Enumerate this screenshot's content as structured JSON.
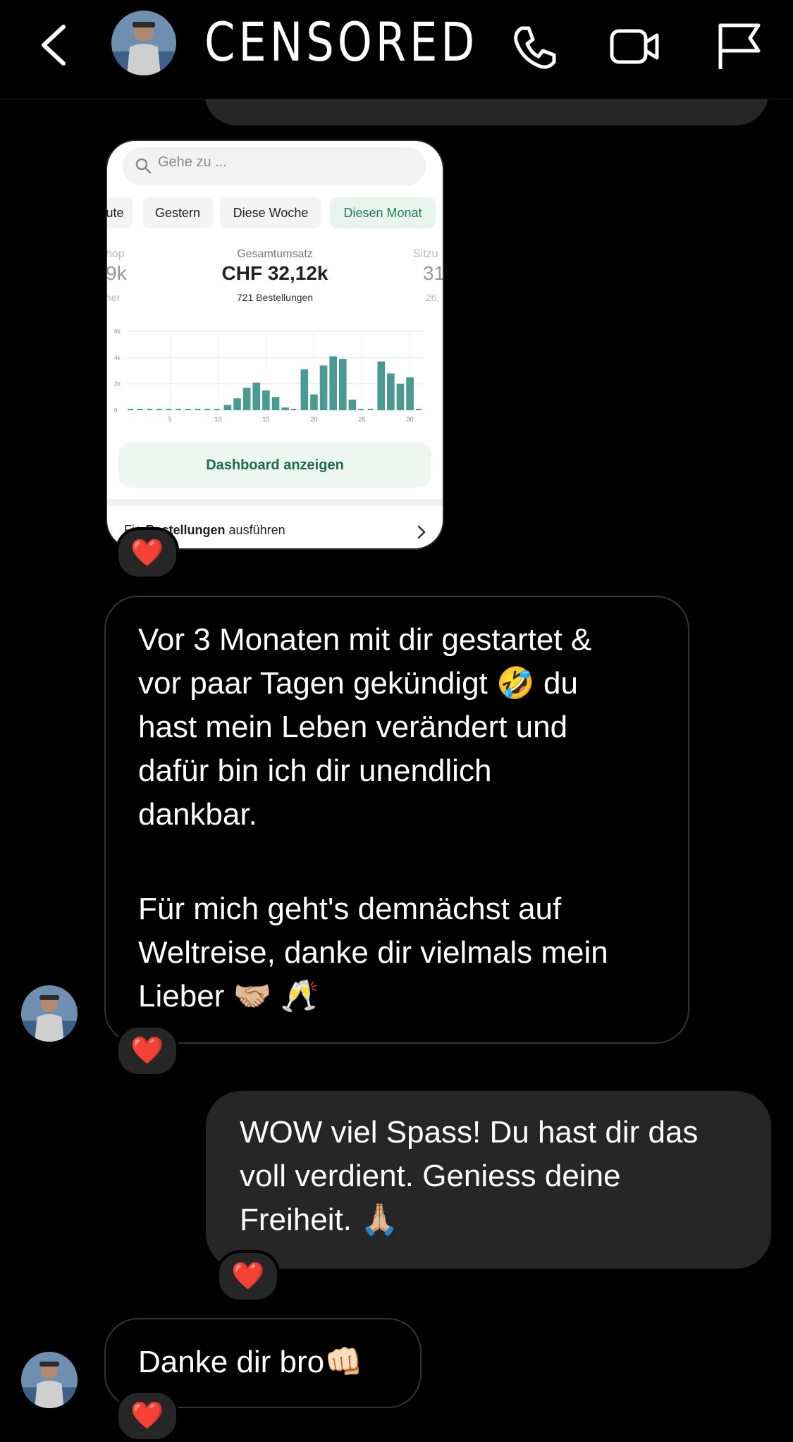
{
  "header": {
    "contact_name": "CENSORED",
    "back_icon": "chevron-left-icon",
    "call_icon": "phone-icon",
    "video_icon": "video-camera-icon",
    "report_icon": "flag-icon"
  },
  "shared_screenshot": {
    "search_placeholder": "Gehe zu ...",
    "tabs": [
      "ute",
      "Gestern",
      "Diese Woche",
      "Diesen Monat"
    ],
    "active_tab": "Diesen Monat",
    "metric_left": {
      "label": "hop",
      "value": "9k",
      "sub": "her"
    },
    "metric_main": {
      "label": "Gesamtumsatz",
      "value": "CHF 32,12k",
      "sub": "721 Bestellungen"
    },
    "metric_right": {
      "label": "Sitzu",
      "value": "31",
      "sub": "26,"
    },
    "dashboard_button": "Dashboard anzeigen",
    "footer_bold": "Bestellungen",
    "footer_rest": " ausführen",
    "footer_prefix": "Fi",
    "chart_data": {
      "type": "bar",
      "x": [
        1,
        2,
        3,
        4,
        5,
        6,
        7,
        8,
        9,
        10,
        11,
        12,
        13,
        14,
        15,
        16,
        17,
        18,
        19,
        20,
        21,
        22,
        23,
        24,
        25,
        26,
        27,
        28,
        29,
        30,
        31
      ],
      "values": [
        0,
        0,
        0,
        0,
        0,
        0,
        0,
        0,
        0,
        0,
        400,
        900,
        1700,
        2100,
        1500,
        1000,
        200,
        0,
        3100,
        1200,
        3400,
        4100,
        3900,
        800,
        0,
        0,
        3700,
        2800,
        2000,
        2500,
        0
      ],
      "ylim": [
        0,
        6000
      ],
      "y_ticks": [
        "0",
        "2k",
        "4k",
        "6k"
      ],
      "x_ticks": [
        "5",
        "10",
        "15",
        "20",
        "25",
        "30"
      ],
      "bar_color": "#4a9a94"
    }
  },
  "reaction": "❤️",
  "messages": {
    "received_1": {
      "paragraph_1": [
        "Vor 3 Monaten mit dir gestartet &",
        "vor paar Tagen gekündigt 🤣 du",
        "hast mein Leben verändert und",
        "dafür bin ich dir unendlich",
        "dankbar."
      ],
      "paragraph_2": [
        "Für mich geht's demnächst auf",
        "Weltreise, danke dir vielmals mein",
        "Lieber 🤝🏼 🥂"
      ]
    },
    "sent_1": [
      "WOW viel Spass! Du hast dir das",
      "voll verdient. Geniess deine",
      "Freiheit. 🙏🏼"
    ],
    "received_2": "Danke dir bro👊🏻"
  }
}
